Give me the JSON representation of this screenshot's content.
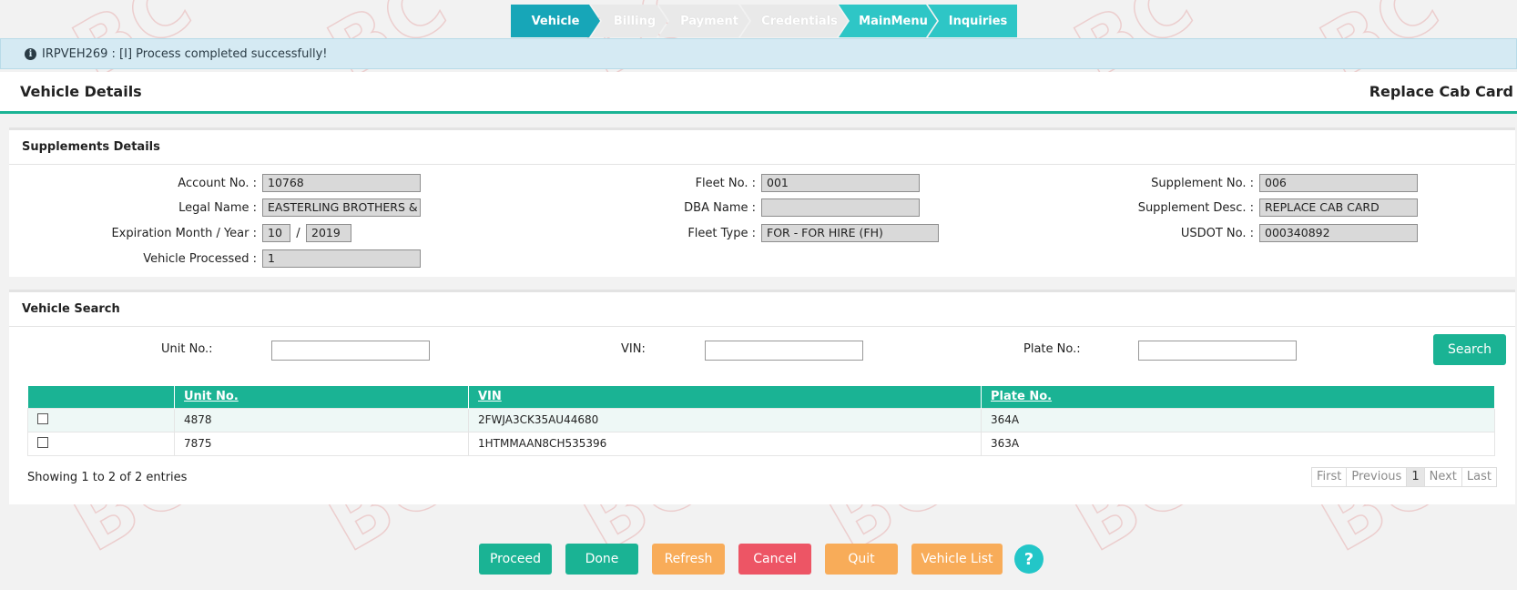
{
  "steps": [
    "Vehicle",
    "Billing",
    "Payment",
    "Credentials",
    "MainMenu",
    "Inquiries"
  ],
  "alert": {
    "message": "IRPVEH269 : [I] Process completed successfully!"
  },
  "header": {
    "title": "Vehicle Details",
    "right_title": "Replace Cab Card"
  },
  "supplements": {
    "heading": "Supplements Details",
    "account_label": "Account No. :",
    "account_value": "10768",
    "legal_label": "Legal Name :",
    "legal_value": "EASTERLING BROTHERS & S",
    "expiry_label": "Expiration Month / Year :",
    "expiry_month": "10",
    "expiry_sep": "/",
    "expiry_year": "2019",
    "processed_label": "Vehicle Processed :",
    "processed_value": "1",
    "fleet_label": "Fleet No. :",
    "fleet_value": "001",
    "dba_label": "DBA Name :",
    "dba_value": "",
    "fleettype_label": "Fleet Type :",
    "fleettype_value": "FOR - FOR HIRE (FH)",
    "suppno_label": "Supplement No. :",
    "suppno_value": "006",
    "suppdesc_label": "Supplement Desc. :",
    "suppdesc_value": "REPLACE CAB CARD",
    "usdot_label": "USDOT No. :",
    "usdot_value": "000340892"
  },
  "search": {
    "heading": "Vehicle Search",
    "unit_label": "Unit No.:",
    "vin_label": "VIN:",
    "plate_label": "Plate No.:",
    "button": "Search"
  },
  "table": {
    "columns": [
      "",
      "Unit No.",
      "VIN",
      "Plate No."
    ],
    "rows": [
      {
        "unit": "4878",
        "vin": "2FWJA3CK35AU44680",
        "plate": "364A"
      },
      {
        "unit": "7875",
        "vin": "1HTMMAAN8CH535396",
        "plate": "363A"
      }
    ],
    "info": "Showing 1 to 2 of 2 entries"
  },
  "pager": {
    "first": "First",
    "previous": "Previous",
    "current": "1",
    "next": "Next",
    "last": "Last"
  },
  "actions": {
    "proceed": "Proceed",
    "done": "Done",
    "refresh": "Refresh",
    "cancel": "Cancel",
    "quit": "Quit",
    "vehicle_list": "Vehicle List",
    "help": "?"
  },
  "colors": {
    "accent": "#1ab394",
    "step_active": "#17a6b8",
    "orange": "#f8ac59",
    "red": "#ed5565"
  }
}
